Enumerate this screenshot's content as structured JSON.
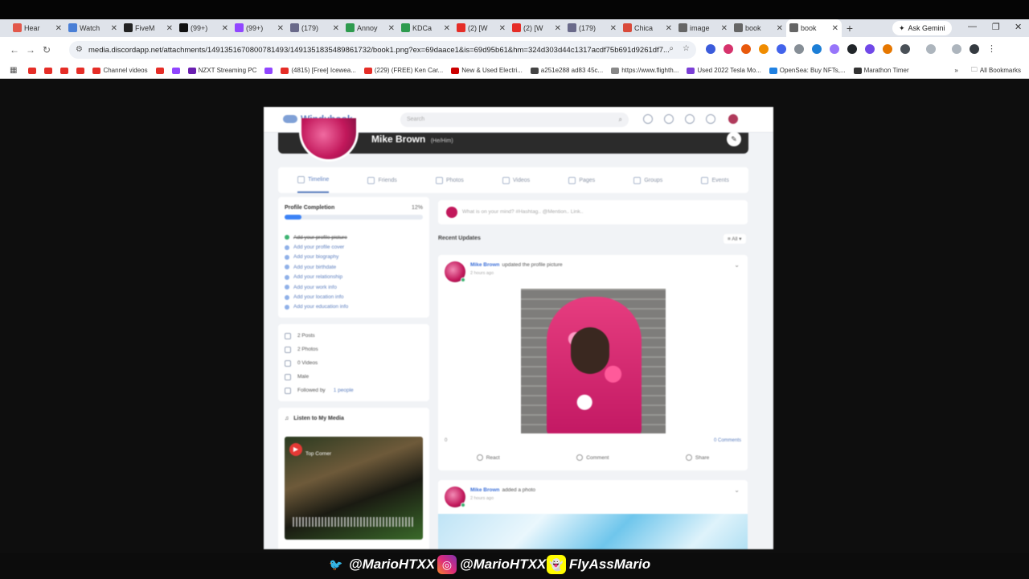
{
  "browser": {
    "tabs": [
      {
        "label": "Hear",
        "color": "#e2584b"
      },
      {
        "label": "Watch",
        "color": "#4a7fd6"
      },
      {
        "label": "FiveM",
        "color": "#222222"
      },
      {
        "label": "(99+)",
        "color": "#111111"
      },
      {
        "label": "(99+)",
        "color": "#9146ff"
      },
      {
        "label": "(179)",
        "color": "#6a6a8a"
      },
      {
        "label": "Annoy",
        "color": "#2e9b4e"
      },
      {
        "label": "KDCa",
        "color": "#2e9b4e"
      },
      {
        "label": "(2) [W",
        "color": "#e52d27"
      },
      {
        "label": "(2) [W",
        "color": "#e52d27"
      },
      {
        "label": "(179)",
        "color": "#6a6a8a"
      },
      {
        "label": "Chica",
        "color": "#d94a3a"
      },
      {
        "label": "image",
        "color": "#666666"
      },
      {
        "label": "book",
        "color": "#666666"
      },
      {
        "label": "book",
        "color": "#666666",
        "active": true
      }
    ],
    "ask_gemini": "Ask Gemini",
    "url": "media.discordapp.net/attachments/1491351670800781493/1491351835489861732/book1.png?ex=69daace1&is=69d95b61&hm=324d303d44c1317acdf75b691d9261df7...",
    "bookmarks": [
      {
        "label": "",
        "color": "#e52d27"
      },
      {
        "label": "",
        "color": "#e52d27"
      },
      {
        "label": "",
        "color": "#e52d27"
      },
      {
        "label": "",
        "color": "#e52d27"
      },
      {
        "label": "Channel videos",
        "color": "#e52d27"
      },
      {
        "label": "",
        "color": "#e52d27"
      },
      {
        "label": "",
        "color": "#9146ff"
      },
      {
        "label": "NZXT Streaming PC",
        "color": "#6a1fb0"
      },
      {
        "label": "",
        "color": "#9146ff"
      },
      {
        "label": "(4815) [Free] Icewea...",
        "color": "#e52d27"
      },
      {
        "label": "(229) (FREE) Ken Car...",
        "color": "#e52d27"
      },
      {
        "label": "New & Used Electri...",
        "color": "#cc0000"
      },
      {
        "label": "a251e288 ad83 45c...",
        "color": "#444444"
      },
      {
        "label": "https://www.flighth...",
        "color": "#888888"
      },
      {
        "label": "Used 2022 Tesla Mo...",
        "color": "#7b3fd6"
      },
      {
        "label": "OpenSea: Buy NFTs,...",
        "color": "#2081e2"
      },
      {
        "label": "Marathon Timer",
        "color": "#333333"
      }
    ],
    "all_bookmarks": "All Bookmarks"
  },
  "windybook": {
    "logo": "Windybook",
    "search_placeholder": "Search",
    "profile_name": "Mike Brown",
    "profile_handle": "(He/Him)",
    "tabs": [
      "Timeline",
      "Friends",
      "Photos",
      "Videos",
      "Pages",
      "Groups",
      "Events"
    ],
    "profile_completion": {
      "title": "Profile Completion",
      "percent_label": "12%",
      "percent": 0.12,
      "items": [
        {
          "label": "Add your profile picture",
          "done": true
        },
        {
          "label": "Add your profile cover",
          "done": false
        },
        {
          "label": "Add your biography",
          "done": false
        },
        {
          "label": "Add your birthdate",
          "done": false
        },
        {
          "label": "Add your relationship",
          "done": false
        },
        {
          "label": "Add your work info",
          "done": false
        },
        {
          "label": "Add your location info",
          "done": false
        },
        {
          "label": "Add your education info",
          "done": false
        }
      ]
    },
    "stats": {
      "posts": "2 Posts",
      "photos": "2 Photos",
      "videos": "0 Videos",
      "gender": "Male",
      "followed_by": "Followed by",
      "followed_link": "1 people"
    },
    "media": {
      "title": "Listen to My Media",
      "track_title": "Top Corner"
    },
    "composer_placeholder": "What is on your mind? #Hashtag.. @Mention.. Link..",
    "recent_updates": "Recent Updates",
    "filter": "All",
    "posts": [
      {
        "author": "Mike Brown",
        "action": "updated the profile picture",
        "time": "2 hours ago",
        "comments": "0 Comments",
        "reactions": "0"
      },
      {
        "author": "Mike Brown",
        "action": "added a photo",
        "time": "2 hours ago"
      }
    ],
    "actions": {
      "react": "React",
      "comment": "Comment",
      "share": "Share"
    }
  },
  "overlay": {
    "twitter": "@MarioHTXX",
    "instagram": "@MarioHTXX",
    "snapchat": "FlyAssMario"
  }
}
